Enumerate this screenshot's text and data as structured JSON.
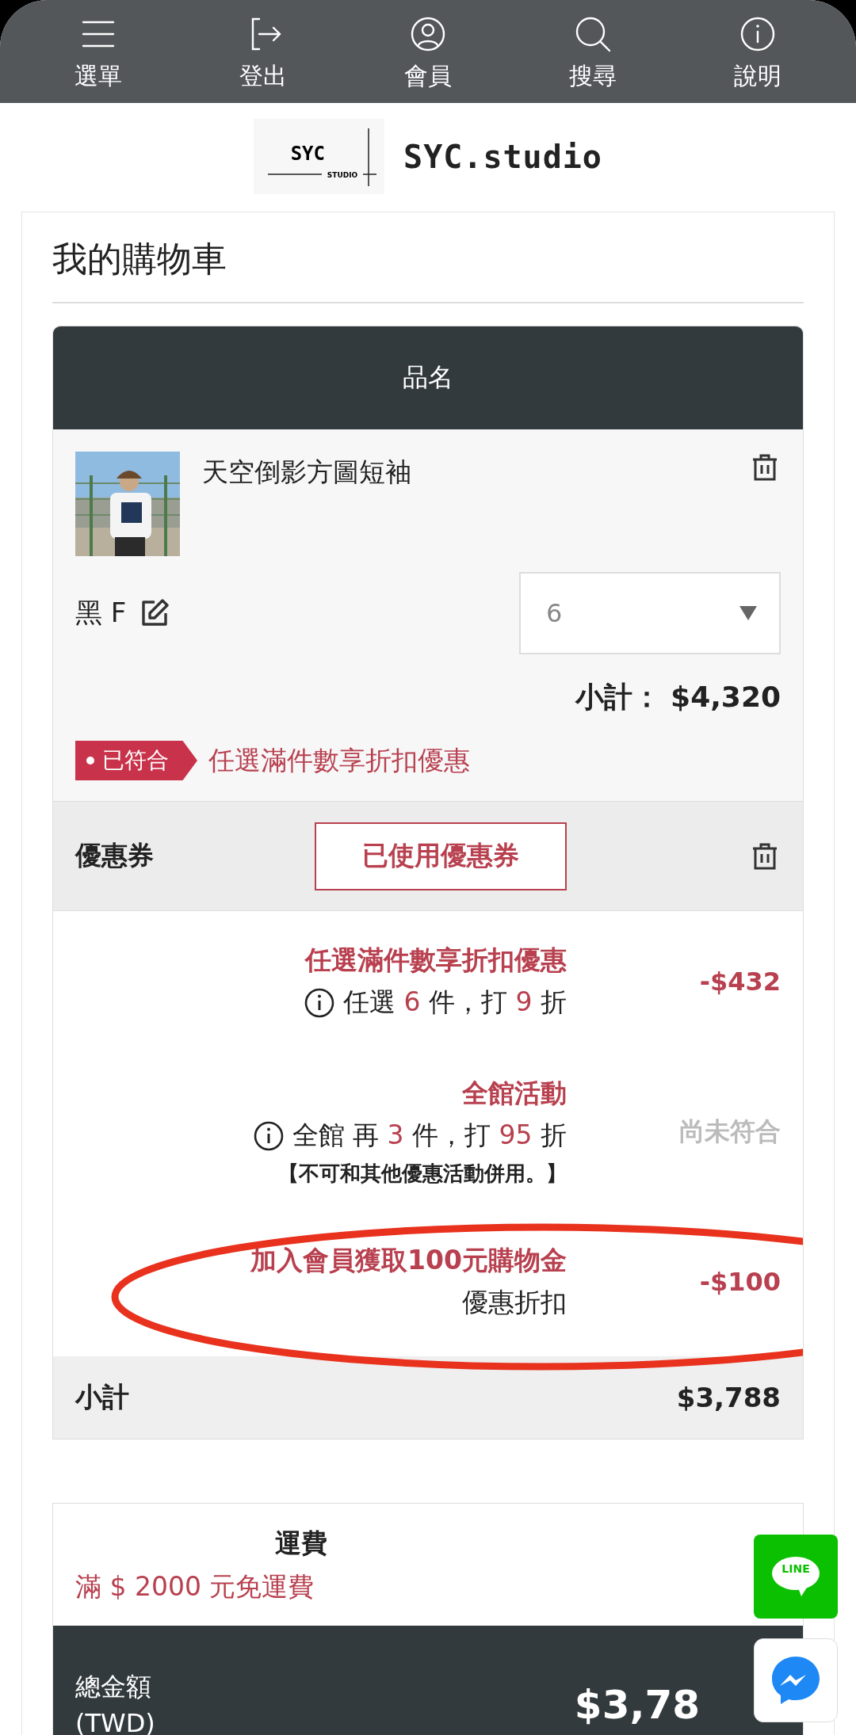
{
  "nav": [
    {
      "label": "選單"
    },
    {
      "label": "登出"
    },
    {
      "label": "會員"
    },
    {
      "label": "搜尋"
    },
    {
      "label": "說明"
    }
  ],
  "logo": {
    "mark": "SYC",
    "sub": "STUDIO",
    "name": "SYC.studio"
  },
  "cart": {
    "title": "我的購物車",
    "column": "品名",
    "item": {
      "name": "天空倒影方圖短袖",
      "variant": "黑 F",
      "quantity": "6",
      "subtotal_label": "小計：",
      "subtotal": "$4,320",
      "promo_tag": {
        "label": "已符合",
        "met": true
      },
      "promo_name": "任選滿件數享折扣優惠"
    },
    "coupon": {
      "label": "優惠券",
      "button": "已使用優惠券"
    },
    "promotions": [
      {
        "title": "任選滿件數享折扣優惠",
        "info": true,
        "parts": [
          {
            "text": "任選 ",
            "accent": false
          },
          {
            "text": "6",
            "accent": true
          },
          {
            "text": " 件，打 ",
            "accent": false
          },
          {
            "text": "9",
            "accent": true
          },
          {
            "text": " 折",
            "accent": false
          }
        ],
        "amount": "-$432",
        "met": true,
        "circled": false
      },
      {
        "title": "全館活動",
        "info": true,
        "parts": [
          {
            "text": "全館 再 ",
            "accent": false
          },
          {
            "text": "3",
            "accent": true
          },
          {
            "text": " 件，打 ",
            "accent": false
          },
          {
            "text": "95",
            "accent": true
          },
          {
            "text": " 折",
            "accent": false
          }
        ],
        "note": "【不可和其他優惠活動併用。】",
        "amount": "尚未符合",
        "met": false,
        "circled": false
      },
      {
        "title": "加入會員獲取100元購物金",
        "info": false,
        "parts": [
          {
            "text": "優惠折扣",
            "accent": false
          }
        ],
        "amount": "-$100",
        "met": true,
        "circled": true
      }
    ],
    "subtotal": {
      "label": "小計",
      "value": "$3,788"
    },
    "shipping": {
      "label": "運費",
      "note": "滿 $ 2000 元免運費"
    },
    "total": {
      "label": "總金額",
      "currency": "(TWD)",
      "value": "$3,78"
    }
  },
  "floating": {
    "line_label": "LINE"
  }
}
